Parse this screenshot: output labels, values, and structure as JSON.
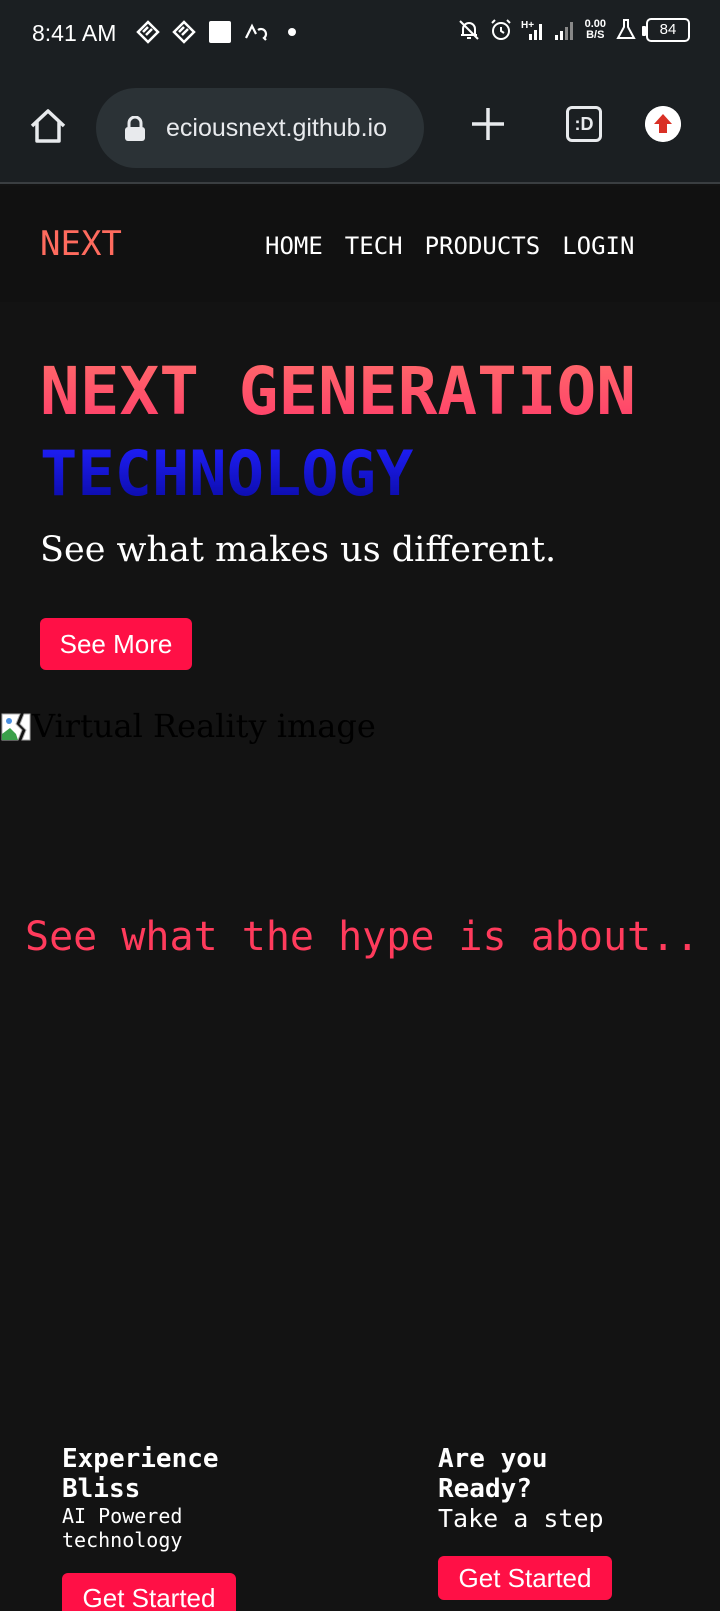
{
  "status_bar": {
    "time": "8:41 AM",
    "battery": "84",
    "net_speed_value": "0.00",
    "net_speed_unit": "B/S",
    "icons_left": [
      "app-icon",
      "app-icon",
      "square-icon",
      "logo-icon",
      "dot-icon"
    ],
    "icons_right": [
      "muted-bell-icon",
      "alarm-icon",
      "signal-h-plus-icon",
      "signal-icon",
      "lab-icon",
      "battery-icon"
    ]
  },
  "browser": {
    "url": "eciousnext.github.io",
    "tabs_label": ":D"
  },
  "site": {
    "logo": "NEXT",
    "nav": [
      "HOME",
      "TECH",
      "PRODUCTS",
      "LOGIN"
    ],
    "hero_title": "NEXT GENERATION",
    "hero_subtitle": "TECHNOLOGY",
    "hero_tagline": "See what makes us different.",
    "see_more_label": "See More",
    "image_alt": "Virtual Reality image",
    "hype_text": "See what the hype is about..",
    "cards": [
      {
        "title_line1": "Experience",
        "title_line2": "Bliss",
        "text_line1": "AI Powered",
        "text_line2": "technology",
        "button": "Get Started"
      },
      {
        "title_line1": "Are you",
        "title_line2": "Ready?",
        "text_line1": "Take a step",
        "button": "Get Started"
      }
    ]
  },
  "colors": {
    "accent_red": "#ff1046",
    "logo": "#ff6b5e",
    "hero_blue": "#1414d0",
    "page_bg": "#131313"
  }
}
